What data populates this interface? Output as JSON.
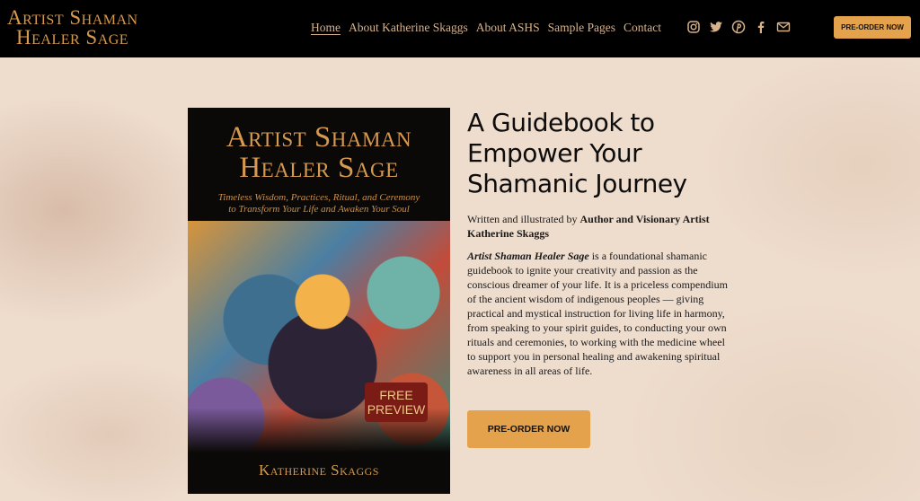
{
  "header": {
    "logo_line1": "Artist Shaman",
    "logo_line2": "Healer Sage",
    "nav": [
      {
        "label": "Home",
        "active": true
      },
      {
        "label": "About Katherine Skaggs",
        "active": false
      },
      {
        "label": "About ASHS",
        "active": false
      },
      {
        "label": "Sample Pages",
        "active": false
      },
      {
        "label": "Contact",
        "active": false
      }
    ],
    "social_icons": [
      "instagram-icon",
      "twitter-icon",
      "pinterest-icon",
      "facebook-icon",
      "email-icon"
    ],
    "cta_label": "PRE-ORDER NOW"
  },
  "book": {
    "title_line1": "Artist Shaman",
    "title_line2": "Healer Sage",
    "subtitle_line1": "Timeless Wisdom, Practices, Ritual, and Ceremony",
    "subtitle_line2": "to Transform Your Life and Awaken Your Soul",
    "badge_line1": "FREE",
    "badge_line2": "PREVIEW",
    "author": "Katherine Skaggs"
  },
  "main": {
    "headline": "A Guidebook to Empower Your Shamanic Journey",
    "credit_prefix": "Written and illustrated by ",
    "credit_bold": "Author and Visionary Artist Katherine Skaggs",
    "desc_title": "Artist Shaman Healer Sage",
    "desc_body": " is a foundational shamanic guidebook to ignite your creativity and passion as the conscious dreamer of your life. It is a priceless compendium of the ancient wisdom of indigenous peoples — giving practical and mystical instruction for living life in harmony, from speaking to your spirit guides, to conducting your own rituals and ceremonies, to working with the medicine wheel to support you in personal healing and awakening spiritual awareness in all areas of life.",
    "cta_label": "PRE-ORDER NOW"
  },
  "colors": {
    "header_bg": "#000000",
    "accent_gold": "#e3a24b",
    "logo_gold": "#d79a4c",
    "page_bg": "#eedccd",
    "badge_red": "#7a1b16"
  }
}
